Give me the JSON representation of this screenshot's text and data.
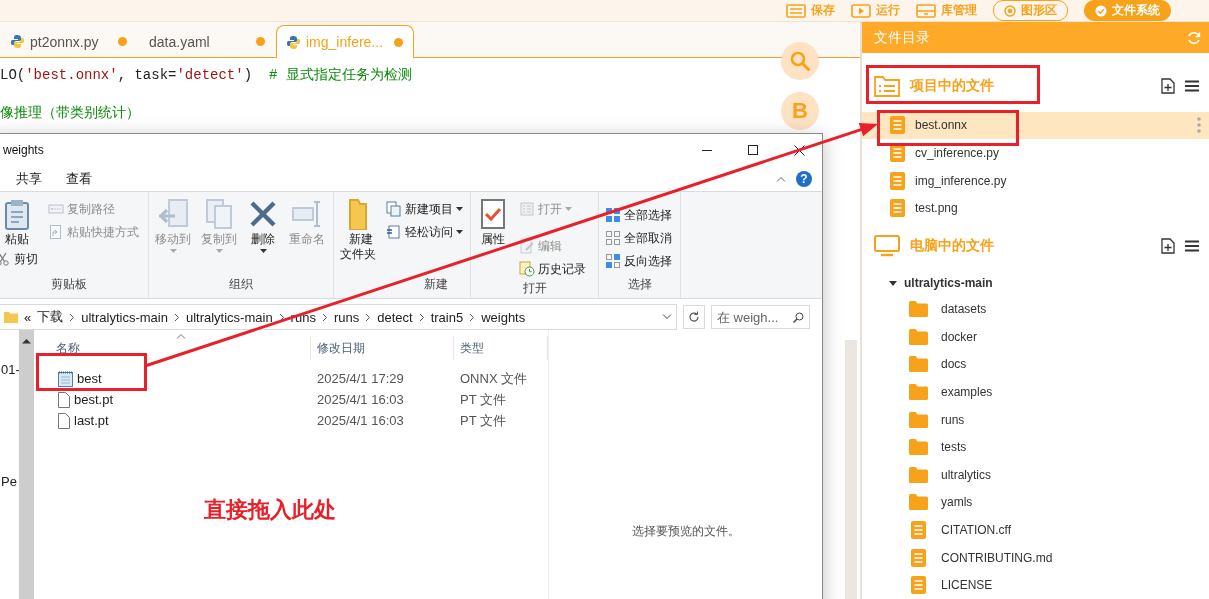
{
  "toolbar": [
    {
      "label": "保存",
      "kind": "plain"
    },
    {
      "label": "运行",
      "kind": "plain"
    },
    {
      "label": "库管理",
      "kind": "plain"
    },
    {
      "label": "图形区",
      "kind": "pill",
      "selected": false
    },
    {
      "label": "文件系统",
      "kind": "pill",
      "selected": true
    }
  ],
  "editor": {
    "tabs": [
      {
        "label": "pt2onnx.py",
        "kind": "python",
        "selected": false,
        "modified": true
      },
      {
        "label": "data.yaml",
        "kind": "yaml",
        "selected": false,
        "modified": true
      },
      {
        "label": "img_infere...",
        "kind": "python",
        "selected": true,
        "modified": true
      }
    ],
    "code_blocks": [
      {
        "lines": [
          {
            "tokens": [
              {
                "kind": "code",
                "text": "LO("
              },
              {
                "kind": "string",
                "text": "'best.onnx'"
              },
              {
                "kind": "code",
                "text": ", task="
              },
              {
                "kind": "string",
                "text": "'detect'"
              },
              {
                "kind": "code",
                "text": ")  "
              },
              {
                "kind": "comment",
                "text": "# 显式指定任务为检测"
              }
            ]
          }
        ]
      },
      {
        "lines": [
          {
            "tokens": [
              {
                "kind": "comment",
                "text": "像推理（带类别统计）"
              }
            ]
          }
        ]
      }
    ],
    "side_buttons": [
      {
        "kind": "search"
      },
      {
        "kind": "letter",
        "label": "B"
      }
    ]
  },
  "explorer": {
    "title": "weights",
    "ribbon_tabs": [
      {
        "label": "共享",
        "selected": false
      },
      {
        "label": "查看",
        "selected": false
      }
    ],
    "help_label": "?",
    "ribbon_groups": [
      {
        "label": "剪贴板",
        "columns": [
          [
            {
              "label": "粘贴",
              "kind": "large",
              "disabled": false,
              "dropdown": false
            },
            {
              "label": "剪切",
              "kind": "small",
              "disabled": false,
              "dropdown": false
            }
          ],
          [
            {
              "label": "复制路径",
              "kind": "small",
              "disabled": true,
              "dropdown": false
            },
            {
              "label": "粘贴快捷方式",
              "kind": "small",
              "disabled": true,
              "dropdown": false
            }
          ]
        ]
      },
      {
        "label": "组织",
        "columns": [
          [
            {
              "label": "移动到",
              "kind": "large",
              "disabled": true,
              "dropdown": true
            }
          ],
          [
            {
              "label": "复制到",
              "kind": "large",
              "disabled": true,
              "dropdown": true
            }
          ],
          [
            {
              "label": "删除",
              "kind": "large",
              "disabled": false,
              "dropdown": true
            }
          ],
          [
            {
              "label": "重命名",
              "kind": "large",
              "disabled": true,
              "dropdown": false
            }
          ]
        ]
      },
      {
        "label": "新建",
        "columns": [
          [
            {
              "label": "新建文件夹",
              "kind": "tall",
              "disabled": false,
              "dropdown": false
            }
          ],
          [
            {
              "label": "新建项目",
              "kind": "small",
              "disabled": false,
              "dropdown": true
            },
            {
              "label": "轻松访问",
              "kind": "small",
              "disabled": false,
              "dropdown": true
            }
          ]
        ]
      },
      {
        "label": "打开",
        "columns": [
          [
            {
              "label": "属性",
              "kind": "large",
              "disabled": false,
              "dropdown": false
            }
          ],
          [
            {
              "label": "打开",
              "kind": "small",
              "disabled": true,
              "dropdown": true
            },
            {
              "label": "编辑",
              "kind": "small",
              "disabled": true,
              "dropdown": false
            },
            {
              "label": "历史记录",
              "kind": "small",
              "disabled": false,
              "dropdown": false
            }
          ]
        ]
      },
      {
        "label": "选择",
        "columns": [
          [
            {
              "label": "全部选择",
              "kind": "small",
              "disabled": false,
              "dropdown": false
            },
            {
              "label": "全部取消",
              "kind": "small",
              "disabled": false,
              "dropdown": false
            },
            {
              "label": "反向选择",
              "kind": "small",
              "disabled": false,
              "dropdown": false
            }
          ]
        ]
      }
    ],
    "overflow_mark": "«",
    "breadcrumbs": [
      "下载",
      "ultralytics-main",
      "ultralytics-main",
      "runs",
      "runs",
      "detect",
      "train5",
      "weights"
    ],
    "search": {
      "placeholder": "在 weigh..."
    },
    "nav_items": [
      "01-",
      "Pe"
    ],
    "columns": [
      "名称",
      "修改日期",
      "类型"
    ],
    "rows": [
      {
        "name": "best",
        "date": "2025/4/1 17:29",
        "type": "ONNX 文件",
        "kind": "onnx"
      },
      {
        "name": "best.pt",
        "date": "2025/4/1 16:03",
        "type": "PT 文件",
        "kind": "file"
      },
      {
        "name": "last.pt",
        "date": "2025/4/1 16:03",
        "type": "PT 文件",
        "kind": "file"
      }
    ],
    "annotation": "直接拖入此处",
    "preview_hint": "选择要预览的文件。"
  },
  "file_panel": {
    "title": "文件目录",
    "project": {
      "title": "项目中的文件",
      "items": [
        {
          "name": "best.onnx",
          "selected": true
        },
        {
          "name": "cv_inference.py",
          "selected": false
        },
        {
          "name": "img_inference.py",
          "selected": false
        },
        {
          "name": "test.png",
          "selected": false
        }
      ]
    },
    "computer": {
      "title": "电脑中的文件",
      "tree": [
        {
          "name": "ultralytics-main",
          "expanded": true,
          "children": [
            {
              "name": "datasets",
              "kind": "folder"
            },
            {
              "name": "docker",
              "kind": "folder"
            },
            {
              "name": "docs",
              "kind": "folder"
            },
            {
              "name": "examples",
              "kind": "folder"
            },
            {
              "name": "runs",
              "kind": "folder"
            },
            {
              "name": "tests",
              "kind": "folder"
            },
            {
              "name": "ultralytics",
              "kind": "folder"
            },
            {
              "name": "yamls",
              "kind": "folder"
            },
            {
              "name": "CITATION.cff",
              "kind": "file"
            },
            {
              "name": "CONTRIBUTING.md",
              "kind": "file"
            },
            {
              "name": "LICENSE",
              "kind": "file"
            }
          ]
        }
      ]
    }
  }
}
